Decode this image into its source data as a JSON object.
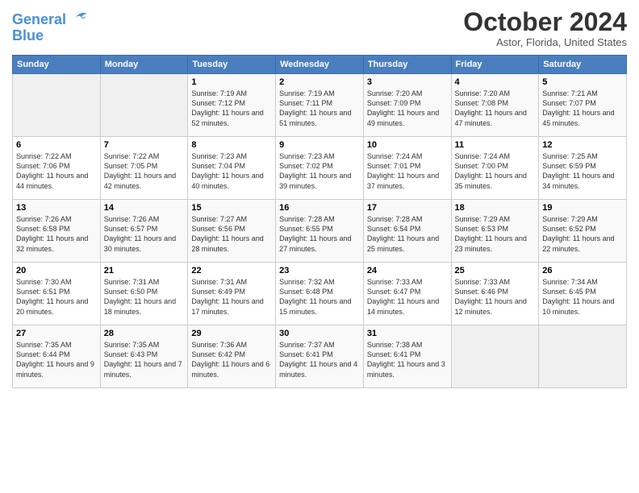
{
  "logo": {
    "line1": "General",
    "line2": "Blue"
  },
  "title": "October 2024",
  "subtitle": "Astor, Florida, United States",
  "days_of_week": [
    "Sunday",
    "Monday",
    "Tuesday",
    "Wednesday",
    "Thursday",
    "Friday",
    "Saturday"
  ],
  "weeks": [
    [
      {
        "num": "",
        "info": ""
      },
      {
        "num": "",
        "info": ""
      },
      {
        "num": "1",
        "info": "Sunrise: 7:19 AM\nSunset: 7:12 PM\nDaylight: 11 hours and 52 minutes."
      },
      {
        "num": "2",
        "info": "Sunrise: 7:19 AM\nSunset: 7:11 PM\nDaylight: 11 hours and 51 minutes."
      },
      {
        "num": "3",
        "info": "Sunrise: 7:20 AM\nSunset: 7:09 PM\nDaylight: 11 hours and 49 minutes."
      },
      {
        "num": "4",
        "info": "Sunrise: 7:20 AM\nSunset: 7:08 PM\nDaylight: 11 hours and 47 minutes."
      },
      {
        "num": "5",
        "info": "Sunrise: 7:21 AM\nSunset: 7:07 PM\nDaylight: 11 hours and 45 minutes."
      }
    ],
    [
      {
        "num": "6",
        "info": "Sunrise: 7:22 AM\nSunset: 7:06 PM\nDaylight: 11 hours and 44 minutes."
      },
      {
        "num": "7",
        "info": "Sunrise: 7:22 AM\nSunset: 7:05 PM\nDaylight: 11 hours and 42 minutes."
      },
      {
        "num": "8",
        "info": "Sunrise: 7:23 AM\nSunset: 7:04 PM\nDaylight: 11 hours and 40 minutes."
      },
      {
        "num": "9",
        "info": "Sunrise: 7:23 AM\nSunset: 7:02 PM\nDaylight: 11 hours and 39 minutes."
      },
      {
        "num": "10",
        "info": "Sunrise: 7:24 AM\nSunset: 7:01 PM\nDaylight: 11 hours and 37 minutes."
      },
      {
        "num": "11",
        "info": "Sunrise: 7:24 AM\nSunset: 7:00 PM\nDaylight: 11 hours and 35 minutes."
      },
      {
        "num": "12",
        "info": "Sunrise: 7:25 AM\nSunset: 6:59 PM\nDaylight: 11 hours and 34 minutes."
      }
    ],
    [
      {
        "num": "13",
        "info": "Sunrise: 7:26 AM\nSunset: 6:58 PM\nDaylight: 11 hours and 32 minutes."
      },
      {
        "num": "14",
        "info": "Sunrise: 7:26 AM\nSunset: 6:57 PM\nDaylight: 11 hours and 30 minutes."
      },
      {
        "num": "15",
        "info": "Sunrise: 7:27 AM\nSunset: 6:56 PM\nDaylight: 11 hours and 28 minutes."
      },
      {
        "num": "16",
        "info": "Sunrise: 7:28 AM\nSunset: 6:55 PM\nDaylight: 11 hours and 27 minutes."
      },
      {
        "num": "17",
        "info": "Sunrise: 7:28 AM\nSunset: 6:54 PM\nDaylight: 11 hours and 25 minutes."
      },
      {
        "num": "18",
        "info": "Sunrise: 7:29 AM\nSunset: 6:53 PM\nDaylight: 11 hours and 23 minutes."
      },
      {
        "num": "19",
        "info": "Sunrise: 7:29 AM\nSunset: 6:52 PM\nDaylight: 11 hours and 22 minutes."
      }
    ],
    [
      {
        "num": "20",
        "info": "Sunrise: 7:30 AM\nSunset: 6:51 PM\nDaylight: 11 hours and 20 minutes."
      },
      {
        "num": "21",
        "info": "Sunrise: 7:31 AM\nSunset: 6:50 PM\nDaylight: 11 hours and 18 minutes."
      },
      {
        "num": "22",
        "info": "Sunrise: 7:31 AM\nSunset: 6:49 PM\nDaylight: 11 hours and 17 minutes."
      },
      {
        "num": "23",
        "info": "Sunrise: 7:32 AM\nSunset: 6:48 PM\nDaylight: 11 hours and 15 minutes."
      },
      {
        "num": "24",
        "info": "Sunrise: 7:33 AM\nSunset: 6:47 PM\nDaylight: 11 hours and 14 minutes."
      },
      {
        "num": "25",
        "info": "Sunrise: 7:33 AM\nSunset: 6:46 PM\nDaylight: 11 hours and 12 minutes."
      },
      {
        "num": "26",
        "info": "Sunrise: 7:34 AM\nSunset: 6:45 PM\nDaylight: 11 hours and 10 minutes."
      }
    ],
    [
      {
        "num": "27",
        "info": "Sunrise: 7:35 AM\nSunset: 6:44 PM\nDaylight: 11 hours and 9 minutes."
      },
      {
        "num": "28",
        "info": "Sunrise: 7:35 AM\nSunset: 6:43 PM\nDaylight: 11 hours and 7 minutes."
      },
      {
        "num": "29",
        "info": "Sunrise: 7:36 AM\nSunset: 6:42 PM\nDaylight: 11 hours and 6 minutes."
      },
      {
        "num": "30",
        "info": "Sunrise: 7:37 AM\nSunset: 6:41 PM\nDaylight: 11 hours and 4 minutes."
      },
      {
        "num": "31",
        "info": "Sunrise: 7:38 AM\nSunset: 6:41 PM\nDaylight: 11 hours and 3 minutes."
      },
      {
        "num": "",
        "info": ""
      },
      {
        "num": "",
        "info": ""
      }
    ]
  ]
}
